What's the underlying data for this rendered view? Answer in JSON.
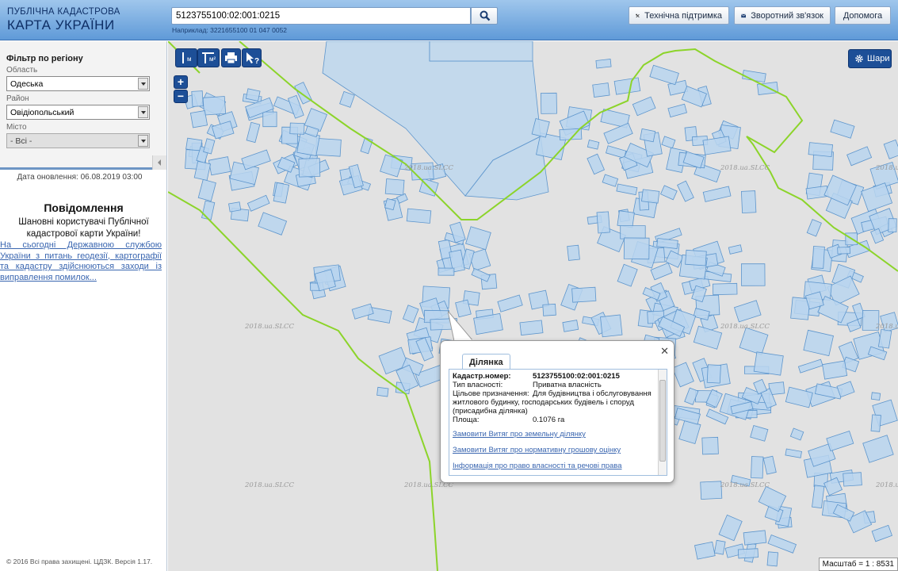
{
  "header": {
    "logo_line1": "ПУБЛІЧНА КАДАСТРОВА",
    "logo_line2": "КАРТА УКРАЇНИ",
    "search_value": "5123755100:02:001:0215",
    "example": "Наприклад: 3221655100 01 047 0052",
    "buttons": {
      "support": "Технічна підтримка",
      "feedback": "Зворотний зв'язок",
      "help": "Допомога"
    }
  },
  "sidebar": {
    "filter_title": "Фільтр по регіону",
    "region_label": "Область",
    "region_value": "Одеська",
    "district_label": "Район",
    "district_value": "Овідіопольський",
    "city_label": "Місто",
    "city_value": "- Всі -",
    "update_date": "Дата оновлення: 06.08.2019 03:00",
    "notice_title": "Повідомлення",
    "notice_greeting": "Шановні користувачі Публічної кадастрової карти України!",
    "notice_link": "На сьогодні Державною службою України з питань геодезії, картографії та кадастру здійснюються заходи із виправлення помилок...",
    "copyright": "© 2016 Всі права захищені. ЦДЗК. Версія 1.17."
  },
  "map": {
    "tools": {
      "zoom_in": "+",
      "zoom_out": "−",
      "measure_length_unit": "м",
      "measure_area_unit": "м²"
    },
    "layers_button": "Шари",
    "watermark": "2018.ua.SLCC",
    "scale": "Масштаб = 1 : 8531"
  },
  "popup": {
    "tab": "Ділянка",
    "rows": [
      {
        "key": "Кадастр.номер:",
        "value": "5123755100:02:001:0215"
      },
      {
        "key": "Тип власності:",
        "value": "Приватна власність"
      },
      {
        "key": "Цільове призначення:",
        "value": "Для будівництва і обслуговування житлового будинку, господарських будівель і споруд (присадибна ділянка)"
      },
      {
        "key": "Площа:",
        "value": "0.1076 га"
      }
    ],
    "links": [
      "Замовити Витяг про земельну ділянку",
      "Замовити Витяг про нормативну грошову оцінку",
      "Інформація про право власності та речові права"
    ]
  },
  "colors": {
    "header": "#6fa5dc",
    "parcel_fill": "#b8d5ef",
    "parcel_stroke": "#5d95cc",
    "boundary_green": "#8cd42a",
    "map_bg": "#e2e2e2",
    "link": "#3a66b0"
  }
}
